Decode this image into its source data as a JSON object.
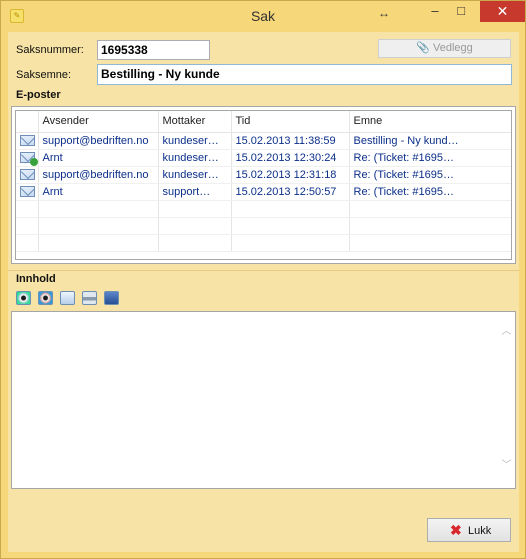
{
  "window": {
    "title": "Sak",
    "app_icon": "note-icon",
    "minimize": "–",
    "maximize": "□",
    "close": "✕"
  },
  "form": {
    "case_number_label": "Saksnummer:",
    "case_number_value": "1695338",
    "attach_label": "Vedlegg",
    "subject_label": "Saksemne:",
    "subject_value": "Bestilling - Ny kunde"
  },
  "emails": {
    "section_title": "E-poster",
    "columns": [
      "Avsender",
      "Mottaker",
      "Tid",
      "Emne"
    ],
    "rows": [
      {
        "icon": "mail-icon",
        "sender": "support@bedriften.no",
        "receiver": "kundeser…",
        "time": "15.02.2013 11:38:59",
        "subject": "Bestilling - Ny kund…"
      },
      {
        "icon": "mail-reply-icon",
        "sender": "Arnt",
        "receiver": "kundeser…",
        "time": "15.02.2013 12:30:24",
        "subject": "Re: (Ticket: #1695…"
      },
      {
        "icon": "mail-icon",
        "sender": "support@bedriften.no",
        "receiver": "kundeser…",
        "time": "15.02.2013 12:31:18",
        "subject": "Re: (Ticket: #1695…"
      },
      {
        "icon": "mail-icon",
        "sender": "Arnt",
        "receiver": "support…",
        "time": "15.02.2013 12:50:57",
        "subject": "Re: (Ticket: #1695…"
      }
    ]
  },
  "content": {
    "section_title": "Innhold",
    "toolbar": [
      "view-html-icon",
      "view-text-icon",
      "copy-icon",
      "print-icon",
      "save-icon"
    ]
  },
  "footer": {
    "close_label": "Lukk"
  },
  "colors": {
    "window_bg": "#f6d77a",
    "client_bg": "#f6e3a5",
    "link_text": "#0b2f8a",
    "close_red": "#c7382d"
  }
}
